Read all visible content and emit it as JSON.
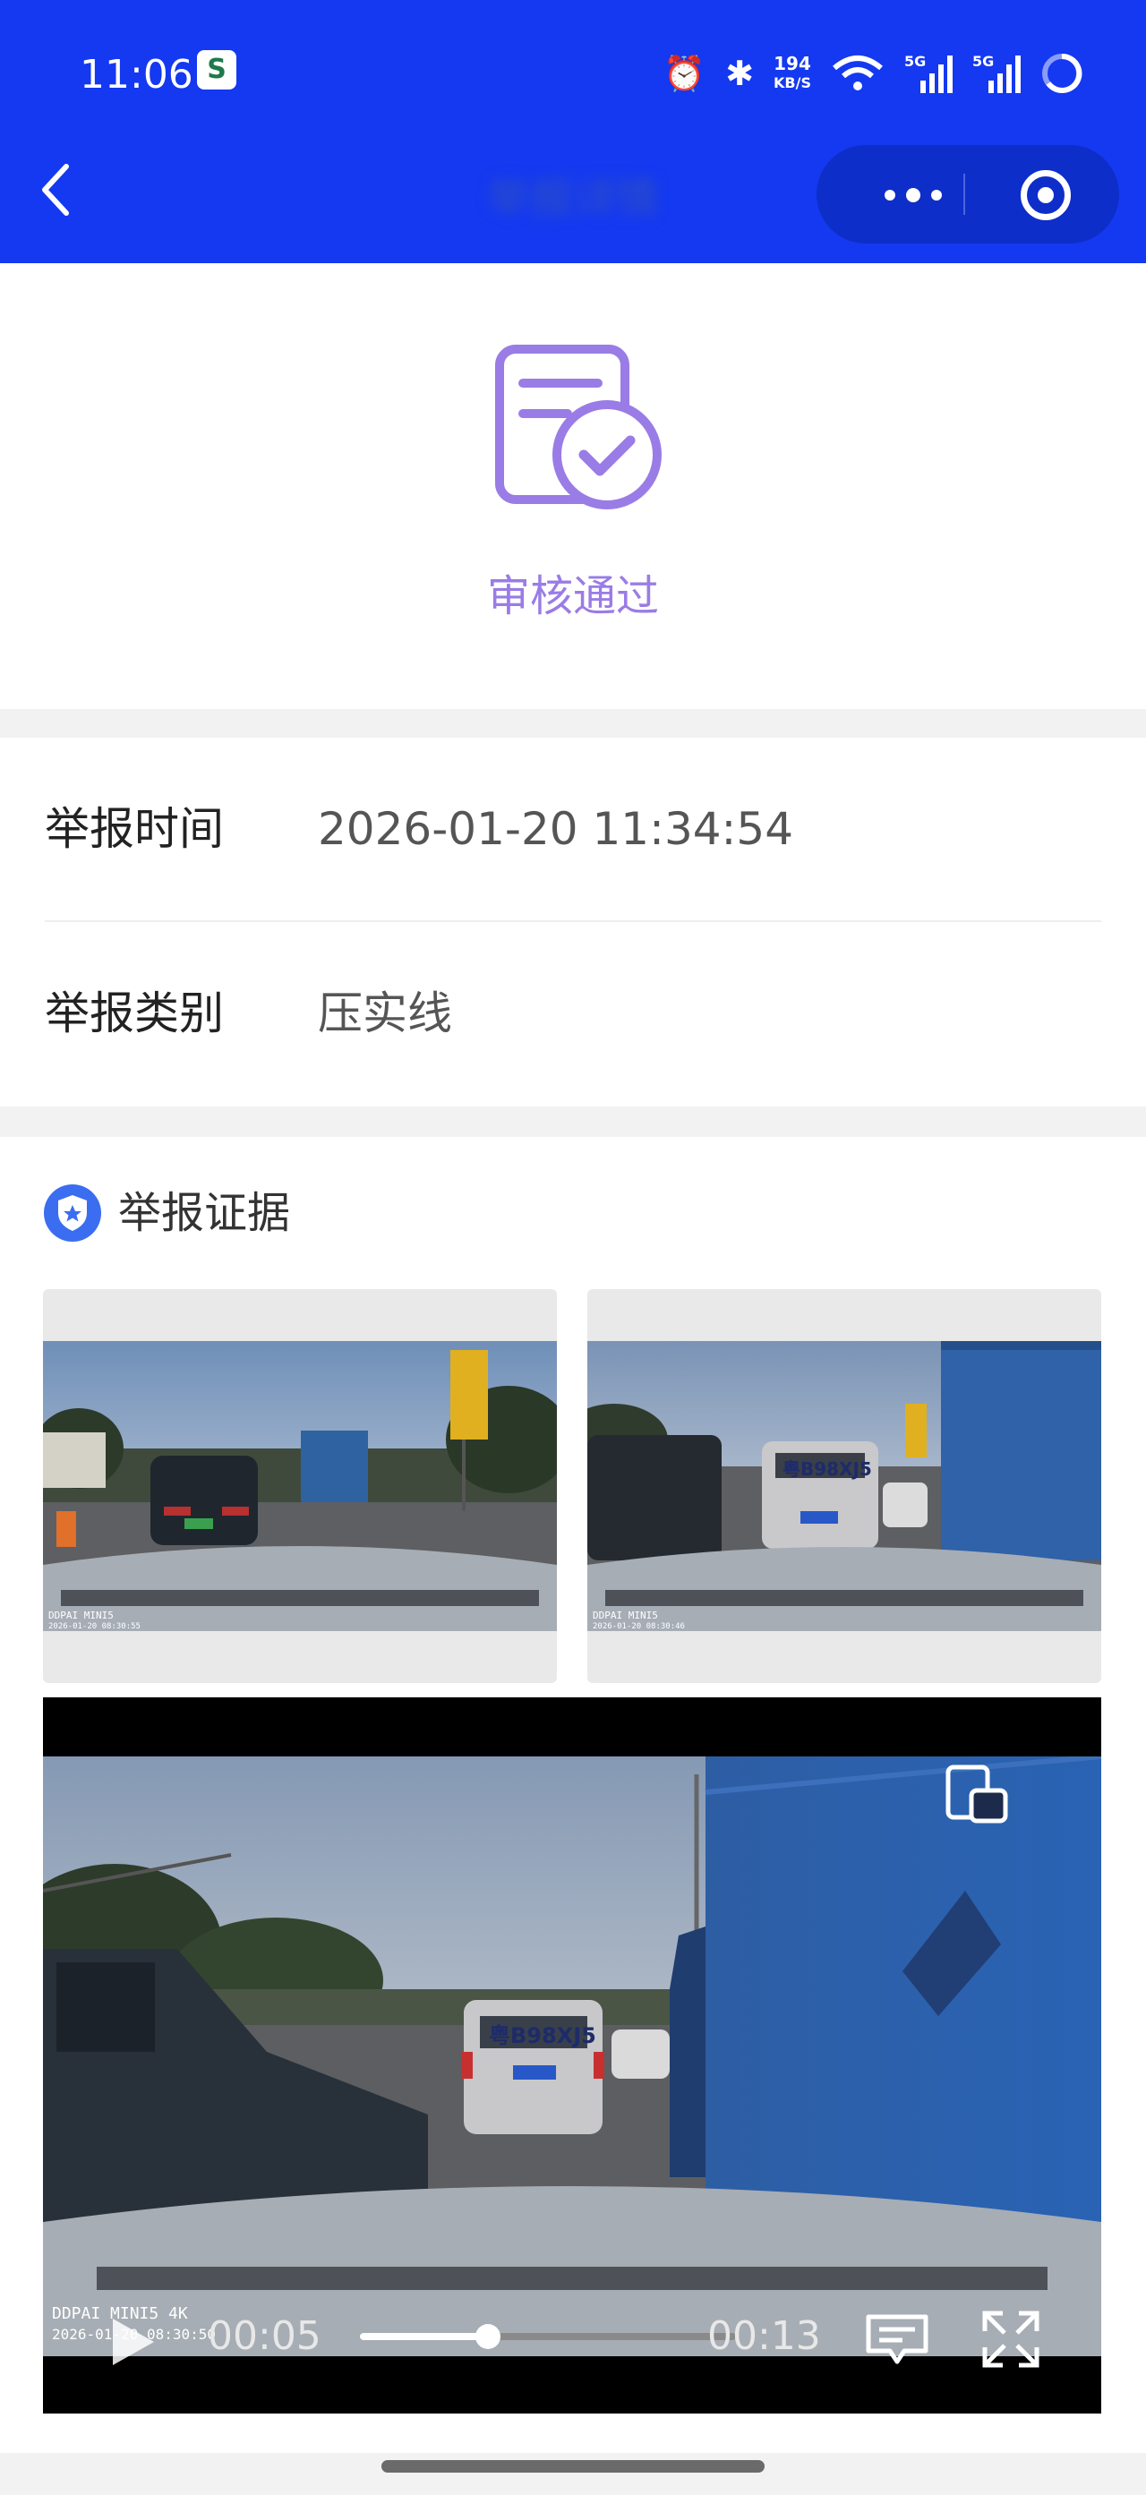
{
  "status_bar": {
    "time": "11:06",
    "app_icon": "S",
    "speed_value": "194",
    "speed_unit": "KB/S",
    "icons": [
      "alarm-icon",
      "bluetooth-icon",
      "wifi-icon",
      "signal-5g-icon",
      "signal-5g-icon",
      "battery-icon"
    ]
  },
  "nav": {
    "back_icon": "chevron-left-icon",
    "title": "举报详情",
    "more_icon": "more-dots-icon",
    "close_icon": "close-target-icon"
  },
  "status": {
    "icon": "approved-document-icon",
    "text": "审核通过",
    "color": "#9a7ce6"
  },
  "report": {
    "time_label": "举报时间",
    "time_value": "2026-01-20 11:34:54",
    "type_label": "举报类别",
    "type_value": "压实线"
  },
  "evidence": {
    "badge_icon": "shield-star-icon",
    "title": "举报证据",
    "photos": [
      {
        "caption": "DDPAI MINI5",
        "stamp": "2026-01-20 08:30:55"
      },
      {
        "caption": "DDPAI MINI5",
        "stamp": "2026-01-20 08:30:46",
        "plate": "粤B98XJ5"
      }
    ],
    "video": {
      "plate": "粤B98XJ5",
      "brand_overlay": "DDPAI MINI5 4K",
      "stamp_overlay": "2026-01-20 08:30:50",
      "current_time": "00:05",
      "total_time": "00:13",
      "progress": 0.34
    }
  },
  "colors": {
    "header_bg": "#1439f0",
    "accent_purple": "#9a7ce6",
    "badge_blue": "#3a6df0"
  }
}
